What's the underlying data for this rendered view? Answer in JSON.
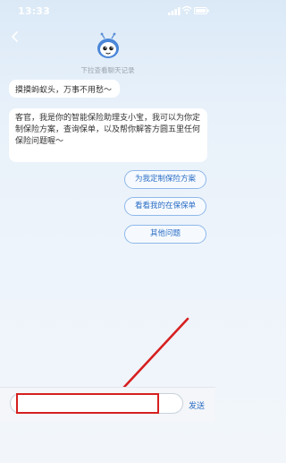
{
  "status_bar": {
    "time": "13:33",
    "time_indicator": "➚"
  },
  "header": {
    "history_hint": "下拉查看聊天记录"
  },
  "messages": [
    {
      "from": "bot",
      "text": "摸摸蚂蚁头，万事不用愁～"
    },
    {
      "from": "bot",
      "text": "客官，我是你的智能保险助理支小宝，我可以为你定制保险方案，查询保单，以及帮你解答方圆五里任何保险问题喔～"
    }
  ],
  "quick_replies": [
    {
      "label": "为我定制保险方案"
    },
    {
      "label": "看看我的在保保单"
    },
    {
      "label": "其他问题"
    }
  ],
  "input": {
    "value": "",
    "placeholder": "",
    "send_label": "发送"
  },
  "colors": {
    "accent": "#2c6ec4",
    "annotation": "#d62020",
    "background": "#e8f1fa"
  },
  "icons": [
    "back-icon",
    "bot-avatar-icon",
    "signal-icon",
    "wifi-icon",
    "battery-icon"
  ]
}
